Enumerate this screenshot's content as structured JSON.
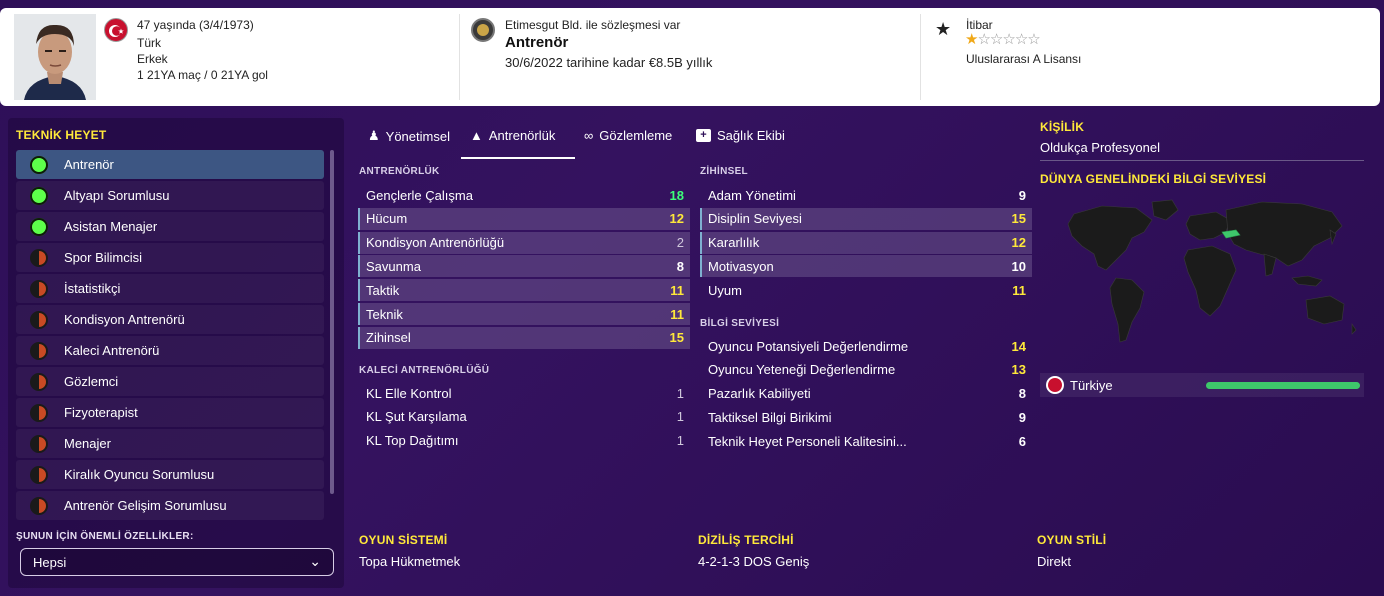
{
  "header": {
    "age_birth": "47 yaşında (3/4/1973)",
    "nationality": "Türk",
    "gender": "Erkek",
    "caps_goals": "1 21YA maç / 0 21YA gol",
    "contract_note": "Etimesgut Bld. ile sözleşmesi var",
    "role": "Antrenör",
    "contract_until": "30/6/2022 tarihine kadar €8.5B yıllık",
    "reputation_label": "İtibar",
    "reputation_stars": 1,
    "reputation_max": 6,
    "license": "Uluslararası A Lisansı"
  },
  "left_panel": {
    "title": "TEKNİK HEYET",
    "items": [
      {
        "label": "Antrenör",
        "status": "green"
      },
      {
        "label": "Altyapı Sorumlusu",
        "status": "green"
      },
      {
        "label": "Asistan Menajer",
        "status": "green"
      },
      {
        "label": "Spor Bilimcisi",
        "status": "half"
      },
      {
        "label": "İstatistikçi",
        "status": "half"
      },
      {
        "label": "Kondisyon Antrenörü",
        "status": "half"
      },
      {
        "label": "Kaleci Antrenörü",
        "status": "half"
      },
      {
        "label": "Gözlemci",
        "status": "half"
      },
      {
        "label": "Fizyoterapist",
        "status": "half"
      },
      {
        "label": "Menajer",
        "status": "half"
      },
      {
        "label": "Kiralık Oyuncu Sorumlusu",
        "status": "half"
      },
      {
        "label": "Antrenör Gelişim Sorumlusu",
        "status": "half"
      }
    ],
    "filter_label": "ŞUNUN İÇİN ÖNEMLİ ÖZELLİKLER:",
    "filter_value": "Hepsi"
  },
  "tabs": [
    {
      "label": "Yönetimsel",
      "icon": "people-icon"
    },
    {
      "label": "Antrenörlük",
      "icon": "cone-icon"
    },
    {
      "label": "Gözlemleme",
      "icon": "binoculars-icon"
    },
    {
      "label": "Sağlık Ekibi",
      "icon": "medkit-icon"
    }
  ],
  "coaching": {
    "title": "ANTRENÖRLÜK",
    "rows": [
      {
        "label": "Gençlerle Çalışma",
        "value": "18"
      },
      {
        "label": "Hücum",
        "value": "12"
      },
      {
        "label": "Kondisyon Antrenörlüğü",
        "value": "2"
      },
      {
        "label": "Savunma",
        "value": "8"
      },
      {
        "label": "Taktik",
        "value": "11"
      },
      {
        "label": "Teknik",
        "value": "11"
      },
      {
        "label": "Zihinsel",
        "value": "15"
      }
    ]
  },
  "gk_coaching": {
    "title": "KALECİ ANTRENÖRLÜĞÜ",
    "rows": [
      {
        "label": "KL Elle Kontrol",
        "value": "1"
      },
      {
        "label": "KL Şut Karşılama",
        "value": "1"
      },
      {
        "label": "KL Top Dağıtımı",
        "value": "1"
      }
    ]
  },
  "mental": {
    "title": "ZİHİNSEL",
    "rows": [
      {
        "label": "Adam Yönetimi",
        "value": "9"
      },
      {
        "label": "Disiplin Seviyesi",
        "value": "15"
      },
      {
        "label": "Kararlılık",
        "value": "12"
      },
      {
        "label": "Motivasyon",
        "value": "10"
      },
      {
        "label": "Uyum",
        "value": "11"
      }
    ]
  },
  "knowledge": {
    "title": "BİLGİ SEVİYESİ",
    "rows": [
      {
        "label": "Oyuncu Potansiyeli Değerlendirme",
        "value": "14"
      },
      {
        "label": "Oyuncu Yeteneği Değerlendirme",
        "value": "13"
      },
      {
        "label": "Pazarlık Kabiliyeti",
        "value": "8"
      },
      {
        "label": "Taktiksel Bilgi Birikimi",
        "value": "9"
      },
      {
        "label": "Teknik Heyet Personeli Kalitesini...",
        "value": "6"
      }
    ]
  },
  "personality": {
    "title": "KİŞİLİK",
    "value": "Oldukça Profesyonel"
  },
  "world_knowledge": {
    "title": "DÜNYA GENELİNDEKİ BİLGİ SEVİYESİ",
    "country": "Türkiye",
    "level": 1.0
  },
  "footer": {
    "system_title": "OYUN SİSTEMİ",
    "system_value": "Topa Hükmetmek",
    "formation_title": "DİZİLİŞ TERCİHİ",
    "formation_value": "4-2-1-3 DOS Geniş",
    "style_title": "OYUN STİLİ",
    "style_value": "Direkt"
  }
}
